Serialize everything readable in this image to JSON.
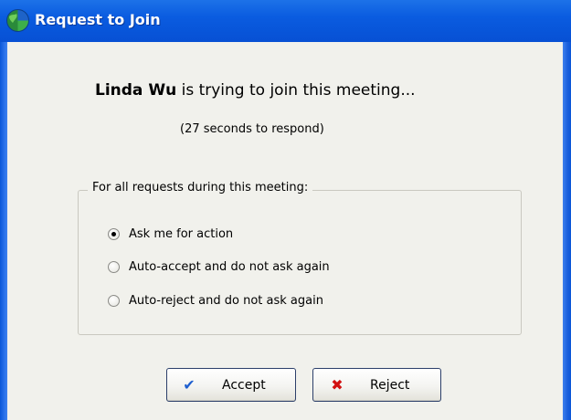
{
  "window": {
    "title": "Request to Join",
    "title_icon": "globe-icon"
  },
  "message": {
    "name": "Linda Wu",
    "text": " is trying to join this meeting...",
    "countdown": "(27 seconds to respond)"
  },
  "group": {
    "legend": "For all requests during this meeting:",
    "options": [
      {
        "label": "Ask me for action",
        "checked": true
      },
      {
        "label": "Auto-accept and do not ask again",
        "checked": false
      },
      {
        "label": "Auto-reject and do not ask again",
        "checked": false
      }
    ]
  },
  "buttons": {
    "accept": {
      "label": "Accept",
      "icon": "checkmark-icon",
      "color": "#1f5fcf"
    },
    "reject": {
      "label": "Reject",
      "icon": "x-icon",
      "color": "#d21010"
    }
  },
  "colors": {
    "titlebar": "#0a5ce0",
    "body_bg": "#f1f1ec"
  }
}
